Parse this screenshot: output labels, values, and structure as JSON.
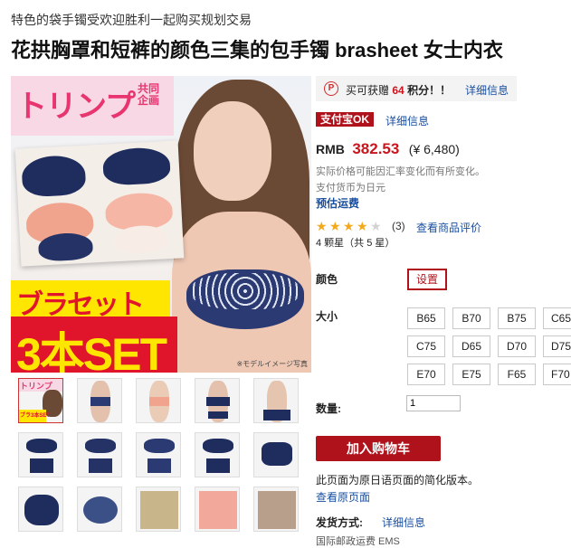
{
  "header": {
    "subtitle": "特色的袋手镯受欢迎胜利一起购买规划交易",
    "title": "花拱胸罩和短裤的颜色三集的包手镯 brasheet 女士内衣"
  },
  "main_image": {
    "promo_top": "トリンプ",
    "promo_top_side": "共同企画",
    "banner_line1": "ブラセット",
    "banner_line2": "3本SET",
    "caption": "※モデルイメージ写真"
  },
  "thumbnails": {
    "first_label_top": "トリンプ",
    "first_label_bottom": "ブラ3本SET"
  },
  "points": {
    "icon": "P",
    "prefix": "买可获赠",
    "amount": "64",
    "suffix": "积分！！",
    "link": "详细信息"
  },
  "alipay": {
    "badge": "支付宝OK",
    "link": "详细信息"
  },
  "price": {
    "label": "RMB",
    "rmb": "382.53",
    "yen": "(¥ 6,480)",
    "note1": "实际价格可能因汇率变化而有所变化。",
    "note2": "支付货币为日元",
    "shipping_link": "预估运费"
  },
  "rating": {
    "value": 4,
    "max": 5,
    "count": "(3)",
    "link": "查看商品评价",
    "summary": "4 颗星（共 5 星）"
  },
  "options": {
    "color_label": "颜色",
    "color_button": "设置",
    "size_label": "大小",
    "sizes": [
      "B65",
      "B70",
      "B75",
      "C65",
      "C75",
      "D65",
      "D70",
      "D75",
      "E70",
      "E75",
      "F65",
      "F70"
    ],
    "quantity_label": "数量:",
    "quantity_value": "1"
  },
  "cart": {
    "button": "加入购物车"
  },
  "footer": {
    "page_note": "此页面为原日语页面的简化版本。",
    "original_link": "查看原页面",
    "shipping_method_label": "发货方式:",
    "shipping_method_link": "详细信息",
    "cut_text": "国际邮政运费 EMS"
  },
  "colors": {
    "accent_red": "#b0121b",
    "price_red": "#c9151e",
    "link_blue": "#1a4fa0",
    "star": "#f4a91b"
  }
}
